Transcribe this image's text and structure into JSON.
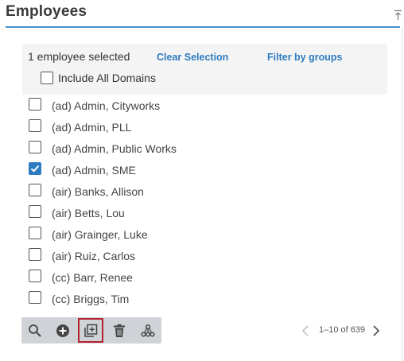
{
  "panel": {
    "title": "Employees",
    "accent_color": "#4a90c8"
  },
  "selection": {
    "count_text": "1 employee selected",
    "clear_label": "Clear Selection",
    "filter_label": "Filter by groups",
    "include_domains_label": "Include All Domains",
    "include_domains_checked": false
  },
  "employees": [
    {
      "label": "(ad) Admin, Cityworks",
      "checked": false
    },
    {
      "label": "(ad) Admin, PLL",
      "checked": false
    },
    {
      "label": "(ad) Admin, Public Works",
      "checked": false
    },
    {
      "label": "(ad) Admin, SME",
      "checked": true
    },
    {
      "label": "(air) Banks, Allison",
      "checked": false
    },
    {
      "label": "(air) Betts, Lou",
      "checked": false
    },
    {
      "label": "(air) Grainger, Luke",
      "checked": false
    },
    {
      "label": "(air) Ruiz, Carlos",
      "checked": false
    },
    {
      "label": "(cc) Barr, Renee",
      "checked": false
    },
    {
      "label": "(cc) Briggs, Tim",
      "checked": false
    }
  ],
  "toolbar": {
    "tools": [
      {
        "icon": "search-icon"
      },
      {
        "icon": "add-circle-icon"
      },
      {
        "icon": "copy-add-icon",
        "active": true
      },
      {
        "icon": "trash-icon"
      },
      {
        "icon": "hierarchy-icon"
      }
    ],
    "highlight_color": "#b3232f"
  },
  "pager": {
    "range": "1–10 of 639",
    "prev_icon": "chevron-left-icon",
    "next_icon": "chevron-right-icon"
  }
}
